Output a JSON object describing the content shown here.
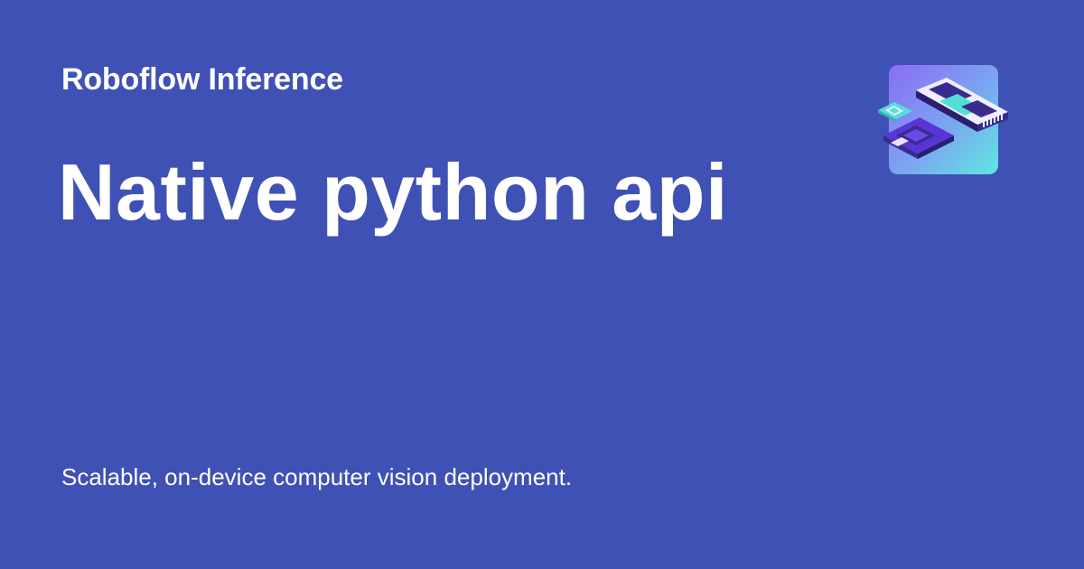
{
  "site": {
    "name": "Roboflow Inference"
  },
  "page": {
    "title": "Native python api",
    "description": "Scalable, on-device computer vision deployment."
  },
  "logo": {
    "icon": "hardware-chip-icon"
  },
  "colors": {
    "background": "#3f51b5",
    "text": "#ffffff",
    "tile_gradient_start": "#8b6cf5",
    "tile_gradient_end": "#5fe8e0",
    "chip_dark": "#3a2c8f",
    "chip_light": "#e9e4ff",
    "accent_cyan": "#53e0d4"
  }
}
